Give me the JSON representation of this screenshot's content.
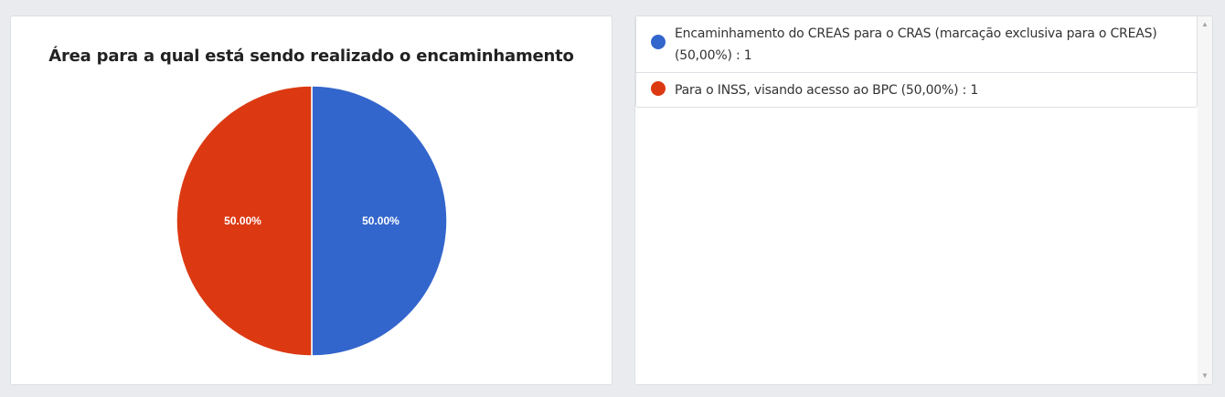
{
  "chart_data": {
    "type": "pie",
    "title": "Área para a qual está sendo realizado o encaminhamento",
    "slices": [
      {
        "label": "Encaminhamento do CREAS para o CRAS (marcação exclusiva para o CREAS)",
        "value": 1,
        "percent": 50.0,
        "percent_label": "50.00%",
        "color": "#3366cc"
      },
      {
        "label": "Para o INSS, visando acesso ao BPC",
        "value": 1,
        "percent": 50.0,
        "percent_label": "50.00%",
        "color": "#dc3912"
      }
    ],
    "start_angle_deg": 0,
    "direction": "clockwise"
  },
  "legend": {
    "items": [
      {
        "text": "Encaminhamento do CREAS para o CRAS (marcação exclusiva para o CREAS) (50,00%) : 1",
        "color": "#3366cc"
      },
      {
        "text": "Para o INSS, visando acesso ao BPC (50,00%) : 1",
        "color": "#dc3912"
      }
    ]
  },
  "scrollbar": {
    "up_glyph": "▲",
    "down_glyph": "▼"
  }
}
